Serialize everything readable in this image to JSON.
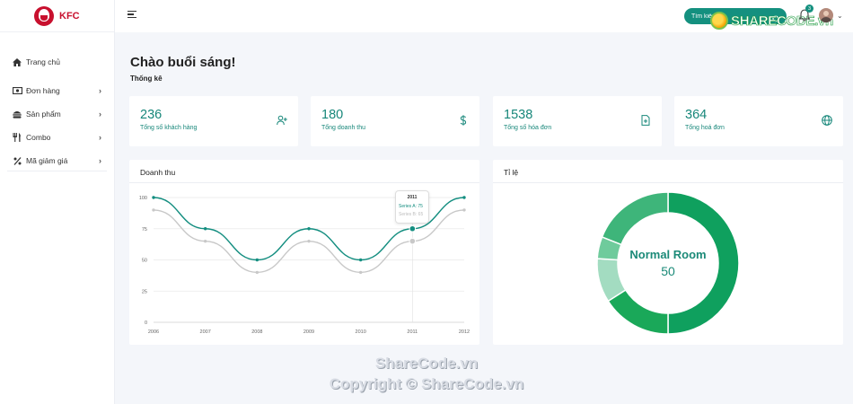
{
  "sidebar": {
    "brand": "KFC",
    "items": [
      {
        "label": "Trang chủ",
        "icon": "home-icon",
        "has_submenu": false
      },
      {
        "label": "Đơn hàng",
        "icon": "money-icon",
        "has_submenu": true
      },
      {
        "label": "Sản phẩm",
        "icon": "hamburger-food-icon",
        "has_submenu": true
      },
      {
        "label": "Combo",
        "icon": "utensils-icon",
        "has_submenu": true
      },
      {
        "label": "Mã giảm giá",
        "icon": "percent-icon",
        "has_submenu": true
      }
    ]
  },
  "topbar": {
    "search_placeholder": "Tìm kiếm...",
    "notification_count": "3",
    "watermark": "SHARECODE.vn"
  },
  "main": {
    "greeting": "Chào buổi sáng!",
    "subtitle": "Thống kê",
    "stats": [
      {
        "value": "236",
        "label": "Tổng số khách hàng",
        "icon": "user-plus-icon"
      },
      {
        "value": "180",
        "label": "Tổng doanh thu",
        "icon": "dollar-icon"
      },
      {
        "value": "1538",
        "label": "Tổng số hóa đơn",
        "icon": "file-plus-icon"
      },
      {
        "value": "364",
        "label": "Tổng hoá đơn",
        "icon": "globe-icon"
      }
    ]
  },
  "revenue_card": {
    "title": "Doanh thu",
    "tooltip": {
      "title": "2011",
      "series_a": "Series A: 75",
      "series_b": "Series B: 65"
    }
  },
  "ratio_card": {
    "title": "Tỉ lệ",
    "center_label": "Normal Room",
    "center_value": "50"
  },
  "chart_data": [
    {
      "type": "line",
      "title": "Doanh thu",
      "x": [
        "2006",
        "2007",
        "2008",
        "2009",
        "2010",
        "2011",
        "2012"
      ],
      "ylim": [
        0,
        100
      ],
      "yticks": [
        0,
        25,
        50,
        75,
        100
      ],
      "grid": true,
      "series": [
        {
          "name": "Series A",
          "color": "#148e80",
          "values": [
            100,
            75,
            50,
            75,
            50,
            75,
            100
          ]
        },
        {
          "name": "Series B",
          "color": "#c8c8c8",
          "values": [
            90,
            65,
            40,
            65,
            40,
            65,
            90
          ]
        }
      ]
    },
    {
      "type": "pie",
      "title": "Tỉ lệ",
      "center_label": "Normal Room",
      "center_value": "50",
      "slices": [
        {
          "value": 50,
          "color": "#0fa05e"
        },
        {
          "value": 16,
          "color": "#1aa859"
        },
        {
          "value": 10,
          "color": "#a3dcc1"
        },
        {
          "value": 5,
          "color": "#6fcb9c"
        },
        {
          "value": 19,
          "color": "#3eb57a"
        }
      ]
    }
  ],
  "watermarks": [
    "ShareCode.vn",
    "Copyright © ShareCode.vn"
  ]
}
